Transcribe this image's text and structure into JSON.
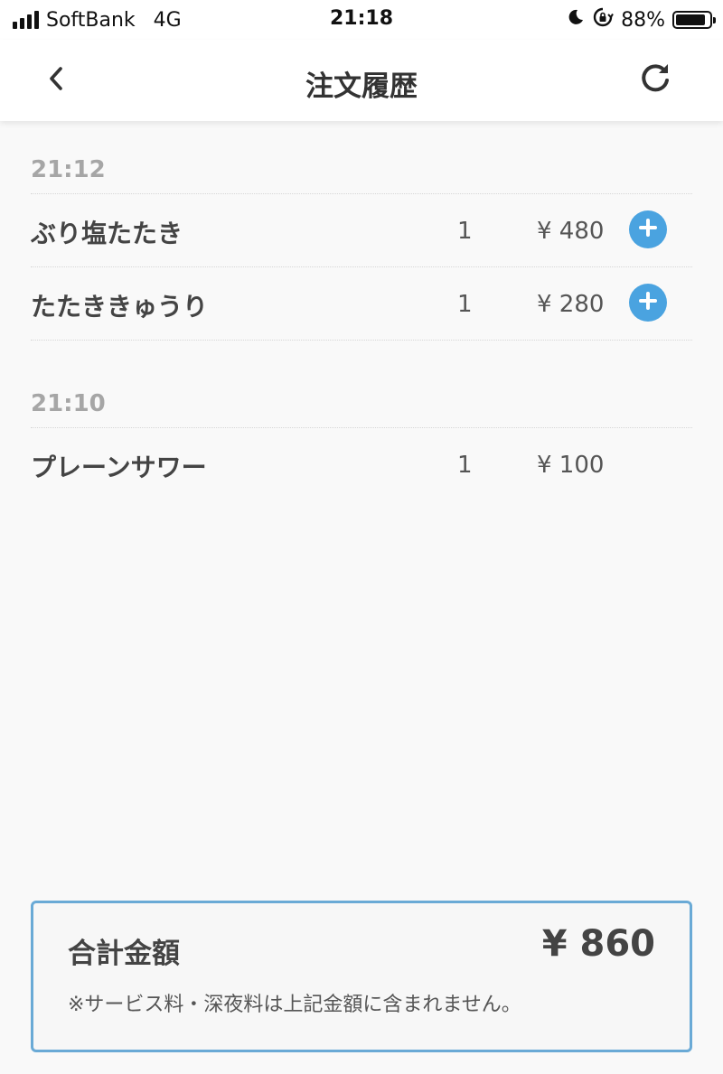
{
  "status_bar": {
    "carrier": "SoftBank",
    "network": "4G",
    "time": "21:18",
    "battery_percent": "88%",
    "battery_level": 0.88
  },
  "nav": {
    "title": "注文履歴",
    "back_icon": "chevron-left-icon",
    "refresh_icon": "refresh-icon"
  },
  "orders": [
    {
      "time": "21:12",
      "items": [
        {
          "name": "ぶり塩たたき",
          "qty": "1",
          "price": "¥ 480",
          "addable": true
        },
        {
          "name": "たたききゅうり",
          "qty": "1",
          "price": "¥ 280",
          "addable": true
        }
      ]
    },
    {
      "time": "21:10",
      "items": [
        {
          "name": "プレーンサワー",
          "qty": "1",
          "price": "¥ 100",
          "addable": false
        }
      ]
    }
  ],
  "total": {
    "label": "合計金額",
    "value": "¥ 860",
    "note": "※サービス料・深夜料は上記金額に含まれません。"
  },
  "colors": {
    "accent": "#4aa3e0",
    "total_border": "#6aaad6",
    "time_text": "#a6a6a6"
  }
}
